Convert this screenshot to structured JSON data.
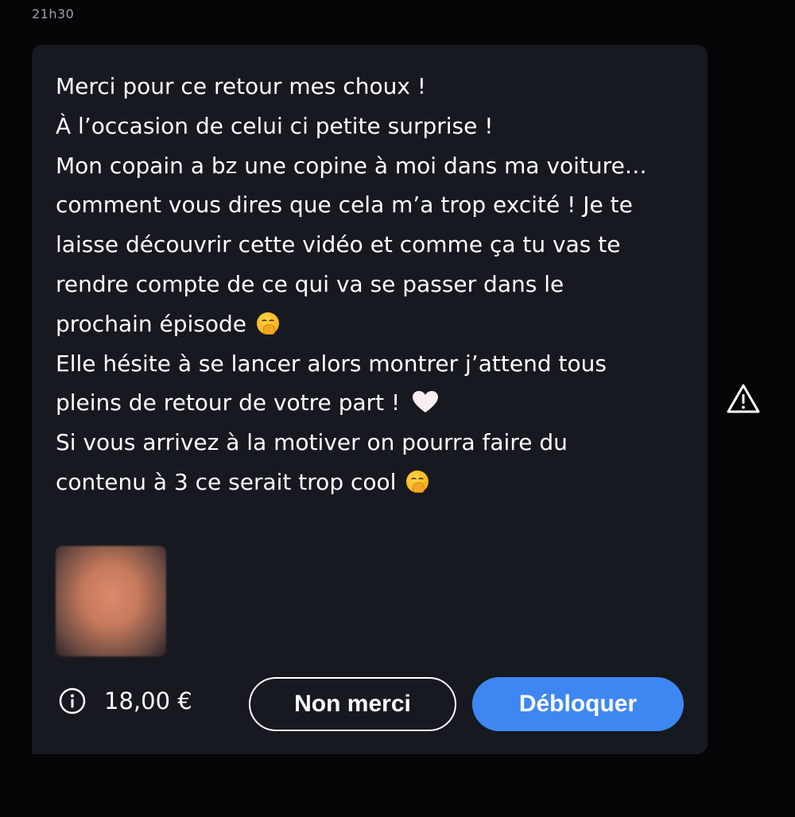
{
  "header": {
    "timestamp": "21h30"
  },
  "message": {
    "lines": [
      "Merci pour ce retour mes choux !",
      "À l’occasion de celui ci petite surprise !",
      "Mon copain a bz une copine à moi dans ma voiture…",
      "comment vous dires que cela m’a trop excité ! Je te",
      "laisse découvrir cette vidéo et comme ça tu vas te",
      "rendre compte de ce qui va se passer dans le",
      "prochain épisode",
      "Elle hésite à se lancer alors montrer j’attend tous",
      "pleins de retour de votre part !",
      "Si vous arrivez à la motiver on pourra faire du",
      "contenu à 3 ce serait trop cool"
    ],
    "emojis": {
      "line_7": "hand-over-mouth-emoji",
      "line_9": "white-heart-emoji",
      "line_11": "hand-over-mouth-emoji"
    }
  },
  "attachment": {
    "icon": "blurred-media-thumbnail"
  },
  "purchase": {
    "price": "18,00 €",
    "info_icon": "info-icon",
    "decline_label": "Non merci",
    "unlock_label": "Débloquer"
  },
  "report": {
    "icon": "warning-icon"
  },
  "colors": {
    "background": "#050507",
    "card": "#16191f",
    "accent": "#3e87f2",
    "timestamp": "#9aa0a8"
  }
}
